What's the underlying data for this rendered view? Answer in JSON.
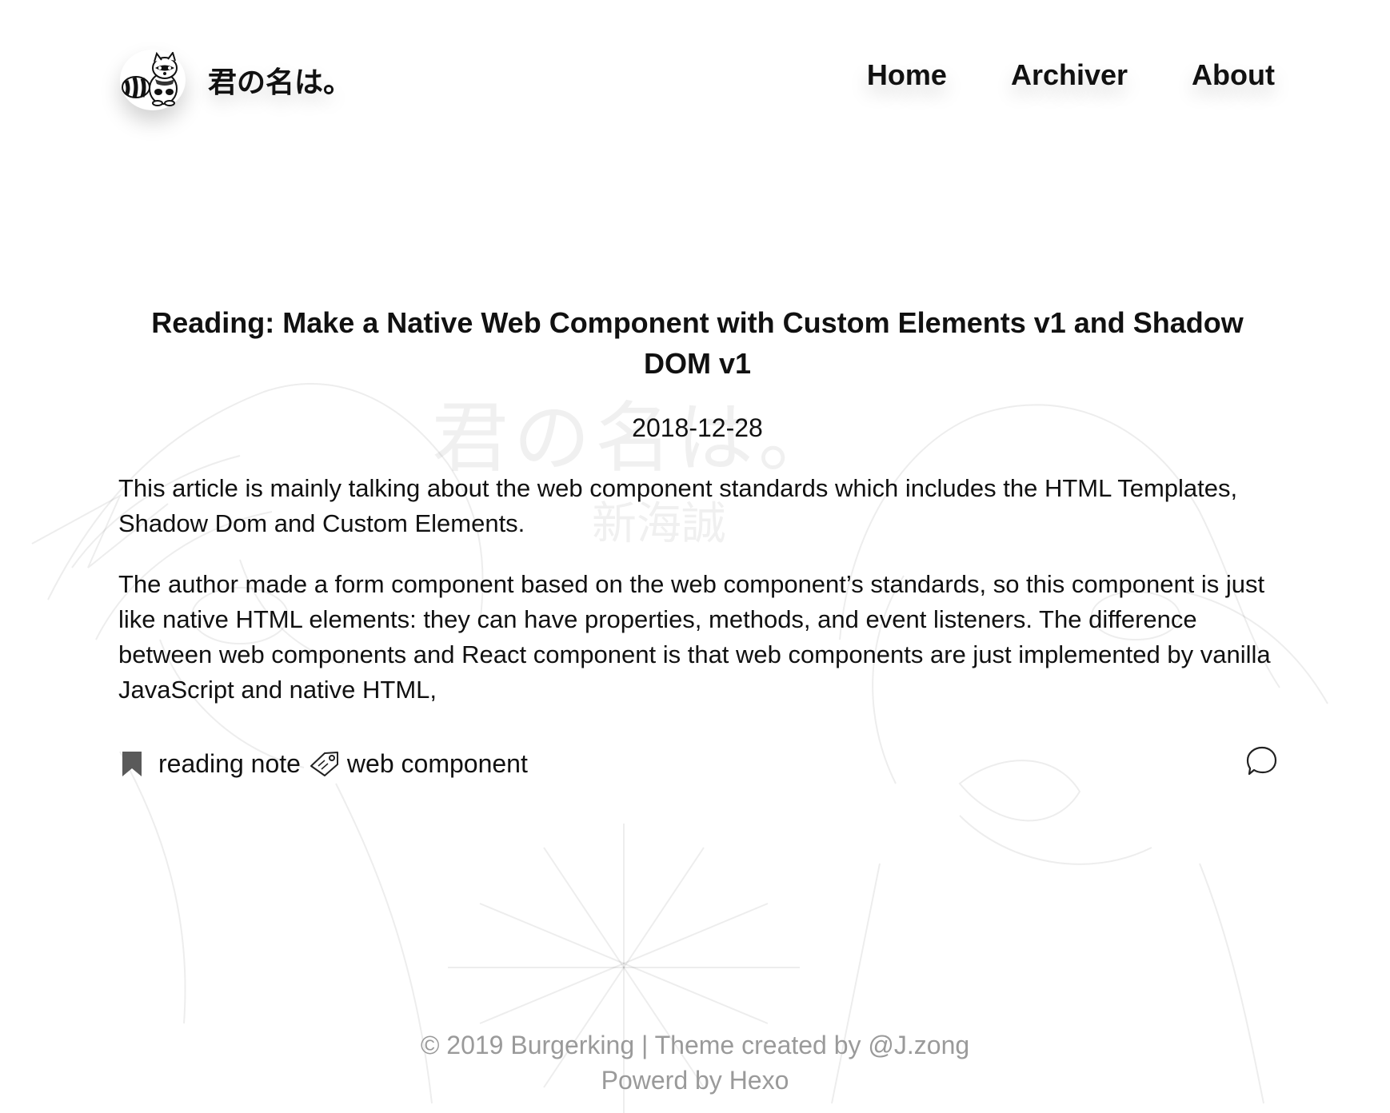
{
  "site": {
    "title": "君の名は。",
    "logo_icon": "raccoon-logo-icon"
  },
  "nav": {
    "items": [
      {
        "label": "Home"
      },
      {
        "label": "Archiver"
      },
      {
        "label": "About"
      }
    ]
  },
  "background": {
    "watermark": "君の名は。",
    "watermark_sub": "新海誠"
  },
  "post": {
    "title": "Reading: Make a Native Web Component with Custom Elements v1 and Shadow DOM v1",
    "date": "2018-12-28",
    "paragraphs": [
      "This article is mainly talking about the web component standards which includes the HTML Templates, Shadow Dom and Custom Elements.",
      "The author made a form component based on the web component’s standards, so this component is just like native HTML elements: they can have properties, methods, and event listeners. The difference between web components and React component is that web components are just implemented by vanilla JavaScript and native HTML,"
    ],
    "category": {
      "label": "reading note",
      "icon": "bookmark-icon"
    },
    "tag": {
      "label": "web component",
      "icon": "tag-icon"
    },
    "comment_icon": "comment-icon"
  },
  "footer": {
    "line1": "© 2019 Burgerking | Theme created by @J.zong",
    "line2": "Powerd by Hexo"
  },
  "colors": {
    "text": "#111111",
    "footer_text": "#9a9a9a",
    "background": "#ffffff"
  }
}
